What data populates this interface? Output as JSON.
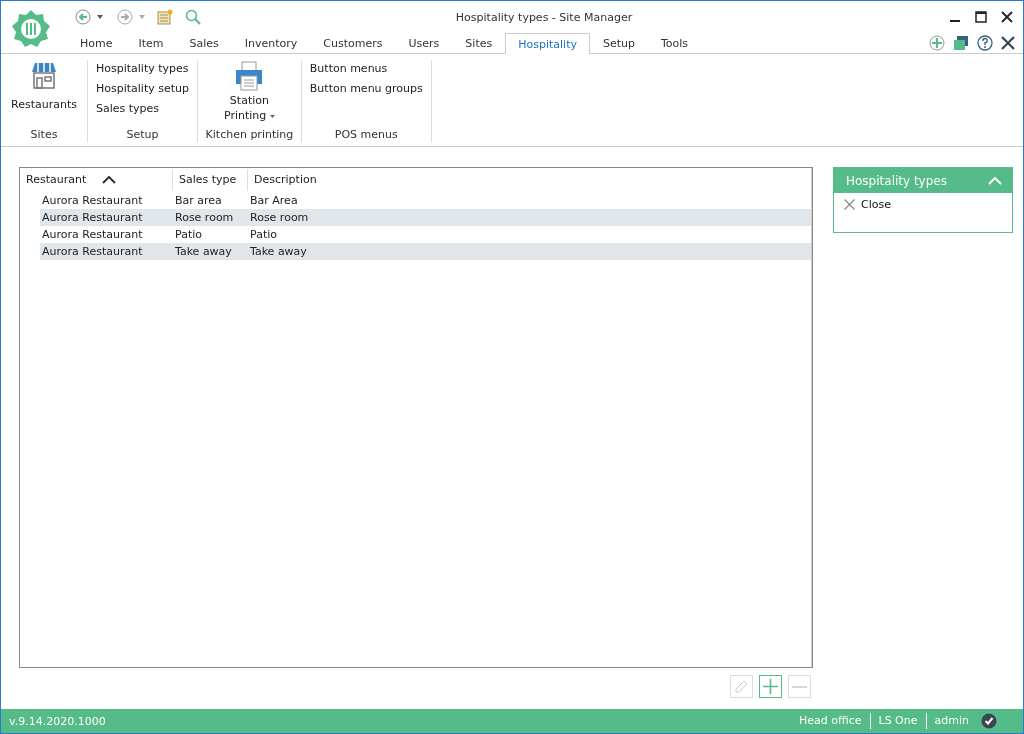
{
  "window": {
    "title": "Hospitality types - Site Manager"
  },
  "tabs": [
    {
      "label": "Home",
      "selected": false
    },
    {
      "label": "Item",
      "selected": false
    },
    {
      "label": "Sales",
      "selected": false
    },
    {
      "label": "Inventory",
      "selected": false
    },
    {
      "label": "Customers",
      "selected": false
    },
    {
      "label": "Users",
      "selected": false
    },
    {
      "label": "Sites",
      "selected": false
    },
    {
      "label": "Hospitality",
      "selected": true
    },
    {
      "label": "Setup",
      "selected": false
    },
    {
      "label": "Tools",
      "selected": false
    }
  ],
  "ribbon": {
    "groups": [
      {
        "label": "Sites",
        "kind": "large",
        "items": [
          {
            "label": "Restaurants",
            "kind": "store"
          }
        ]
      },
      {
        "label": "Setup",
        "kind": "list",
        "items": [
          {
            "label": "Hospitality types"
          },
          {
            "label": "Hospitality setup"
          },
          {
            "label": "Sales types"
          }
        ]
      },
      {
        "label": "Kitchen printing",
        "kind": "large",
        "items": [
          {
            "label": "Station",
            "label2": "Printing",
            "kind": "printer"
          }
        ]
      },
      {
        "label": "POS menus",
        "kind": "list",
        "items": [
          {
            "label": "Button menus"
          },
          {
            "label": "Button menu groups"
          }
        ]
      }
    ]
  },
  "table": {
    "columns": [
      {
        "label": "Restaurant",
        "sorted": true
      },
      {
        "label": "Sales type",
        "sorted": false
      },
      {
        "label": "Description",
        "sorted": false
      }
    ],
    "rows": [
      [
        "Aurora Restaurant",
        "Bar area",
        "Bar Area"
      ],
      [
        "Aurora Restaurant",
        "Rose room",
        "Rose room"
      ],
      [
        "Aurora Restaurant",
        "Patio",
        "Patio"
      ],
      [
        "Aurora Restaurant",
        "Take away",
        "Take away"
      ]
    ]
  },
  "row_buttons": [
    {
      "kind": "edit",
      "disabled": true
    },
    {
      "kind": "add",
      "disabled": false
    },
    {
      "kind": "remove",
      "disabled": true
    }
  ],
  "side_panel": {
    "title": "Hospitality types",
    "items": [
      {
        "label": "Close"
      }
    ]
  },
  "status_bar": {
    "version": "v.9.14.2020.1000",
    "items": [
      "Head office",
      "LS One",
      "admin"
    ]
  }
}
